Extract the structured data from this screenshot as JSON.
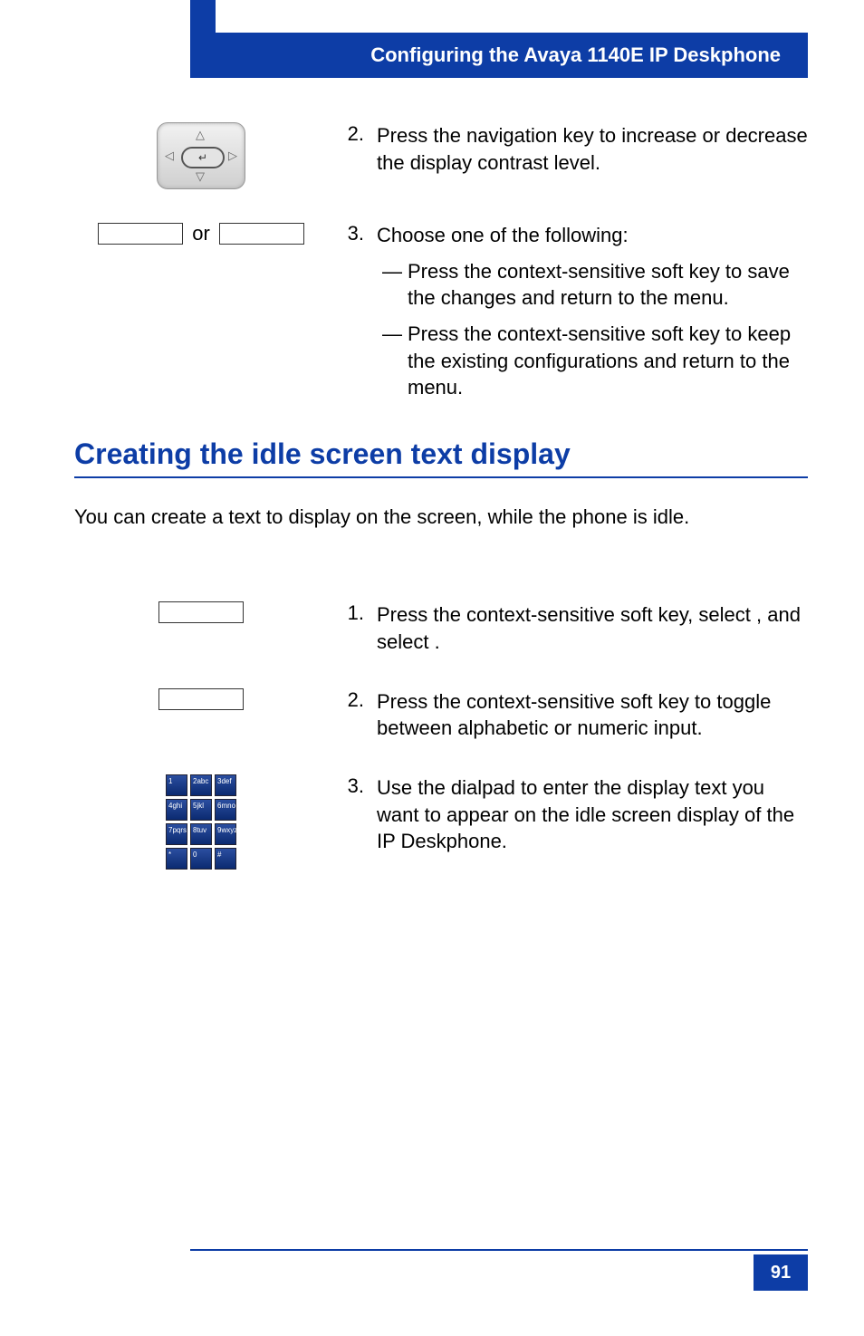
{
  "header": {
    "title": "Configuring the Avaya 1140E IP Deskphone"
  },
  "top_steps": {
    "step2": {
      "num": "2.",
      "text_a": "Press the ",
      "text_b": " navigation key to increase or decrease the display contrast level."
    },
    "step3": {
      "num": "3.",
      "intro": "Choose one of the following:",
      "dash": "—",
      "bullet1_a": "Press the ",
      "bullet1_b": " context-sensitive soft key to save the changes and return to the ",
      "bullet1_c": " menu.",
      "bullet2_a": "Press the ",
      "bullet2_b": " context-sensitive soft key to keep the existing configurations and return to the ",
      "bullet2_c": " menu."
    },
    "or": "or"
  },
  "section": {
    "title": "Creating the idle screen text display",
    "intro": "You can create a text to display on the screen, while the phone is idle."
  },
  "bottom_steps": {
    "step1": {
      "num": "1.",
      "a": "Press the ",
      "b": " context-sensitive soft key, select ",
      "c": ", and select ",
      "d": "."
    },
    "step2": {
      "num": "2.",
      "a": "Press the ",
      "b": " context-sensitive soft key to toggle between alphabetic or numeric input."
    },
    "step3": {
      "num": "3.",
      "a": "Use the dialpad to enter the display text you want to appear on the idle screen display of the IP Deskphone."
    }
  },
  "dialpad_keys": [
    "1",
    "2abc",
    "3def",
    "4ghi",
    "5jkl",
    "6mno",
    "7pqrs",
    "8tuv",
    "9wxyz",
    "*",
    "0",
    "#"
  ],
  "page_number": "91"
}
